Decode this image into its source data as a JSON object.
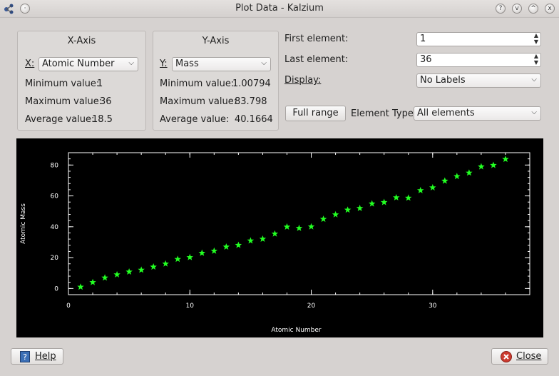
{
  "window": {
    "title": "Plot Data - Kalzium",
    "buttons": [
      "?",
      "v",
      "^",
      "x"
    ]
  },
  "x_axis": {
    "title": "X-Axis",
    "label": "X:",
    "selected": "Atomic Number",
    "min_label": "Minimum value:",
    "min_value": "1",
    "max_label": "Maximum value:",
    "max_value": "36",
    "avg_label": "Average value:",
    "avg_value": "18.5"
  },
  "y_axis": {
    "title": "Y-Axis",
    "label": "Y:",
    "selected": "Mass",
    "min_label": "Minimum value:",
    "min_value": "1.00794",
    "max_label": "Maximum value:",
    "max_value": "83.798",
    "avg_label": "Average value:",
    "avg_value": "40.1664"
  },
  "controls": {
    "first_element_label": "First element:",
    "first_element_value": "1",
    "last_element_label": "Last element:",
    "last_element_value": "36",
    "display_label": "Display:",
    "display_value": "No Labels",
    "full_range_label": "Full range",
    "element_type_label": "Element Type",
    "element_type_value": "All elements"
  },
  "footer": {
    "help_label": "Help",
    "close_label": "Close"
  },
  "colors": {
    "marker": "#22ff22",
    "plot_bg": "#000000",
    "axis": "#ffffff"
  },
  "chart_data": {
    "type": "scatter",
    "xlabel": "Atomic Number",
    "ylabel": "Atomic Mass",
    "xlim": [
      0,
      38
    ],
    "ylim": [
      -4,
      88
    ],
    "xticks": [
      0,
      10,
      20,
      30
    ],
    "yticks": [
      0,
      20,
      40,
      60,
      80
    ],
    "marker": "star",
    "x": [
      1,
      2,
      3,
      4,
      5,
      6,
      7,
      8,
      9,
      10,
      11,
      12,
      13,
      14,
      15,
      16,
      17,
      18,
      19,
      20,
      21,
      22,
      23,
      24,
      25,
      26,
      27,
      28,
      29,
      30,
      31,
      32,
      33,
      34,
      35,
      36
    ],
    "y": [
      1.01,
      4.0,
      6.94,
      9.01,
      10.81,
      12.01,
      14.01,
      16.0,
      19.0,
      20.18,
      22.99,
      24.31,
      26.98,
      28.09,
      30.97,
      32.07,
      35.45,
      39.95,
      39.1,
      40.08,
      44.96,
      47.87,
      50.94,
      52.0,
      54.94,
      55.85,
      58.93,
      58.69,
      63.55,
      65.38,
      69.72,
      72.63,
      74.92,
      78.97,
      79.9,
      83.8
    ]
  }
}
